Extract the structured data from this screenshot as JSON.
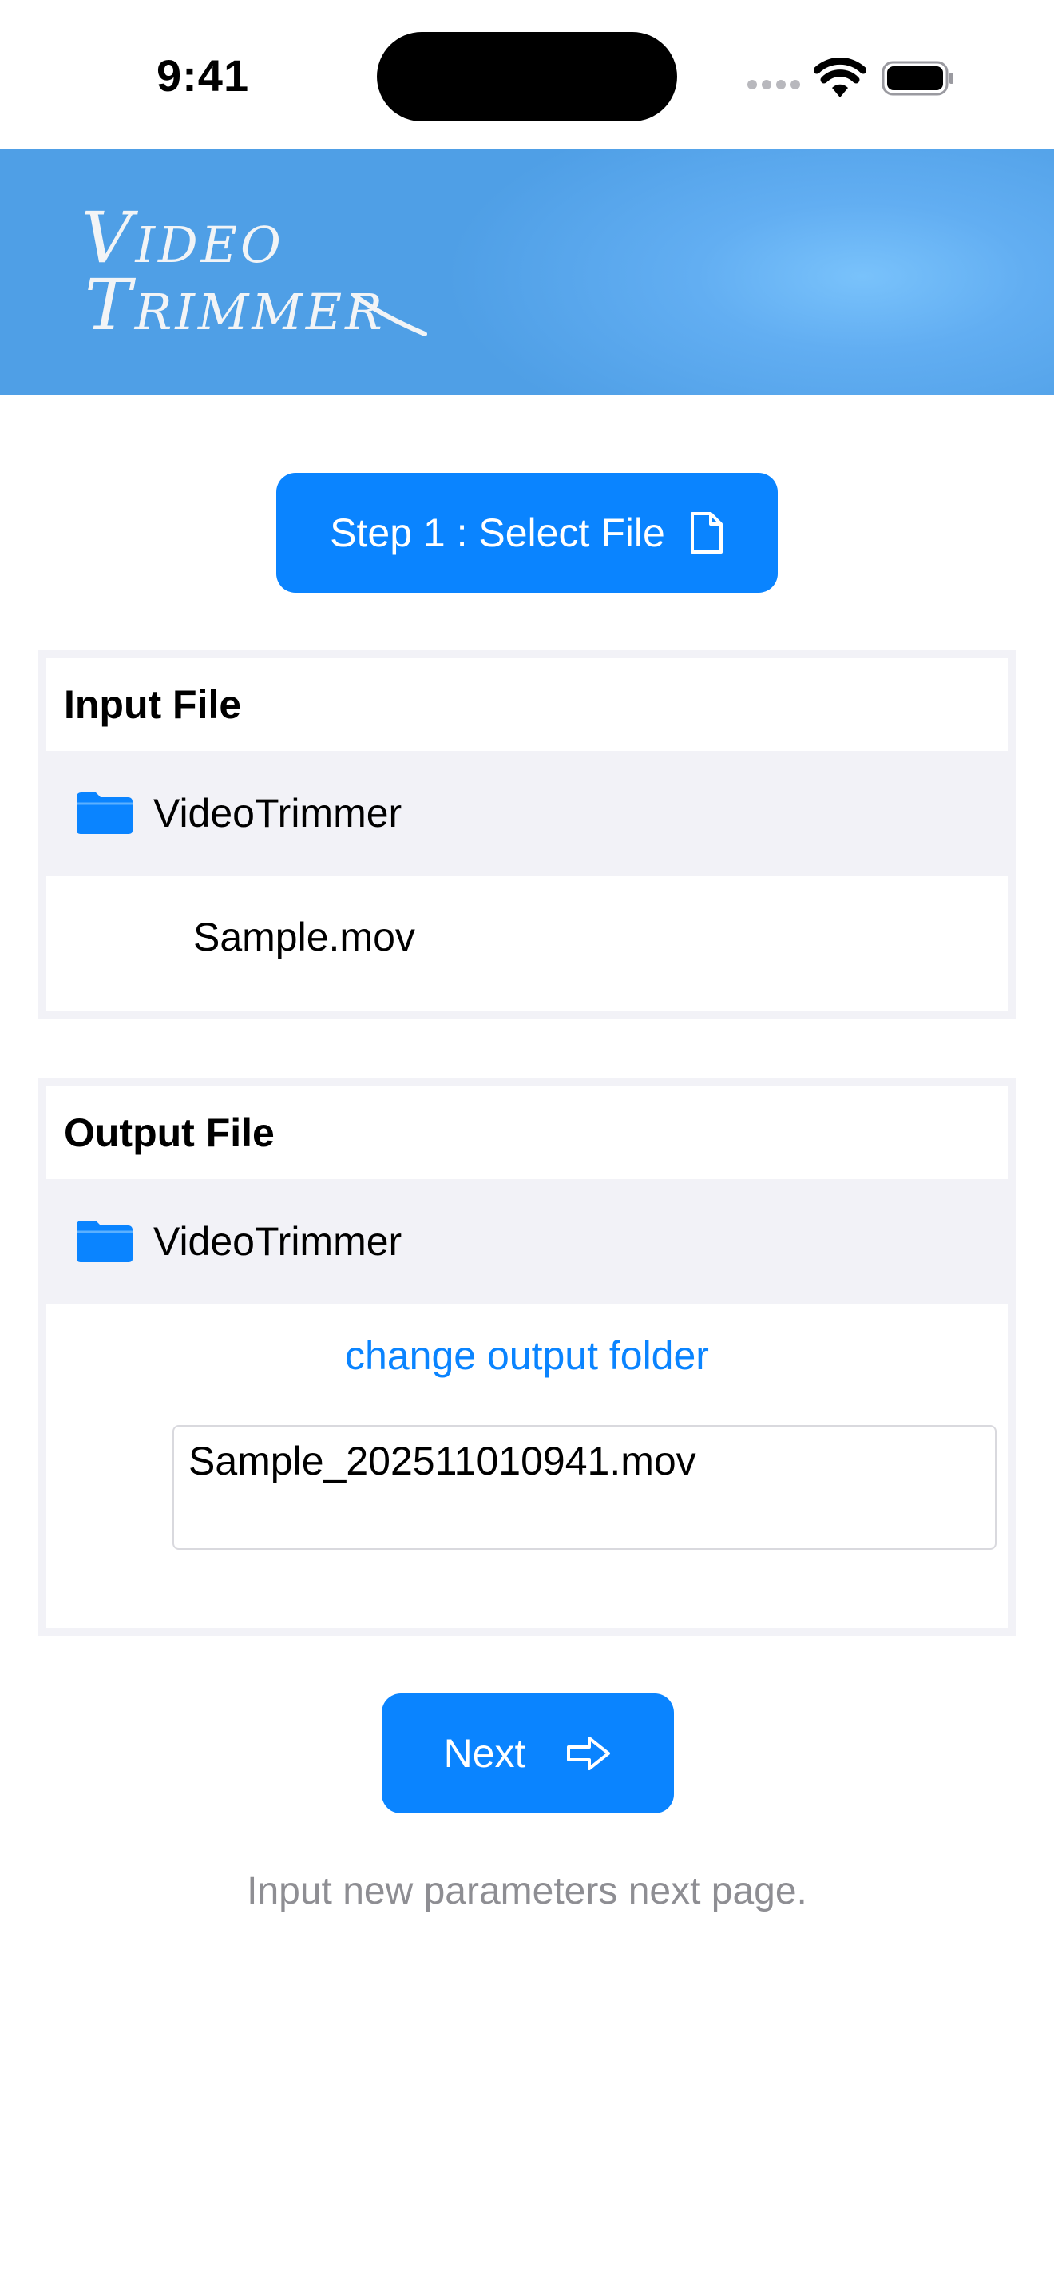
{
  "status_bar": {
    "time": "9:41"
  },
  "banner": {
    "title_line1": "Video",
    "title_line2": "Trimmer"
  },
  "select_button": {
    "label": "Step 1 : Select File",
    "icon": "document-icon"
  },
  "input_panel": {
    "header": "Input File",
    "folder": "VideoTrimmer",
    "file_name": "Sample.mov"
  },
  "output_panel": {
    "header": "Output File",
    "folder": "VideoTrimmer",
    "change_folder_link": "change output folder",
    "output_file_name": "Sample_202511010941.mov"
  },
  "next_button": {
    "label": "Next",
    "icon": "arrow-right-icon"
  },
  "hint": "Input new parameters next page.",
  "colors": {
    "accent": "#0a84ff",
    "banner": "#5aa8ee",
    "panel_bg": "#f2f2f7",
    "hint": "#8e8e93"
  }
}
